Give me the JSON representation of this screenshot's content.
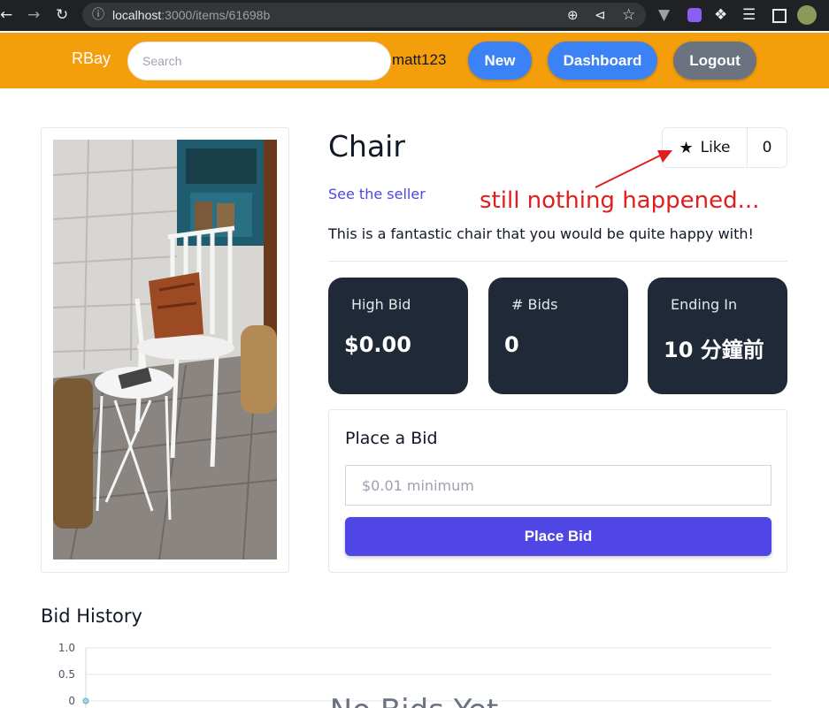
{
  "browser": {
    "url_host": "localhost",
    "url_path": ":3000/items/61698b",
    "back_icon": "arrow-left-icon",
    "forward_icon": "arrow-right-icon",
    "reload_icon": "reload-icon"
  },
  "navbar": {
    "brand": "RBay",
    "search_placeholder": "Search",
    "username": "matt123",
    "buttons": {
      "new": "New",
      "dashboard": "Dashboard",
      "logout": "Logout"
    },
    "colors": {
      "bar": "#f59e0b",
      "primary": "#3b82f6",
      "logout": "#6b7280"
    }
  },
  "item": {
    "title": "Chair",
    "seller_link": "See the seller",
    "description": "This is a fantastic chair that you would be quite happy with!",
    "like_label": "Like",
    "like_count": "0"
  },
  "annotation": "still nothing happened...",
  "stats": [
    {
      "label": "High Bid",
      "value": "$0.00"
    },
    {
      "label": "# Bids",
      "value": "0"
    },
    {
      "label": "Ending In",
      "value": "10 分鐘前"
    }
  ],
  "bid": {
    "title": "Place a Bid",
    "placeholder": "$0.01 minimum",
    "button": "Place Bid"
  },
  "history": {
    "title": "Bid History",
    "empty_text": "No Bids Yet"
  },
  "chart_data": {
    "type": "line",
    "title": "",
    "xlabel": "",
    "ylabel": "",
    "y_ticks": [
      "1.0",
      "0.5",
      "0"
    ],
    "ylim": [
      0,
      1
    ],
    "series": [
      {
        "values": [
          0
        ]
      }
    ],
    "grid": true
  }
}
